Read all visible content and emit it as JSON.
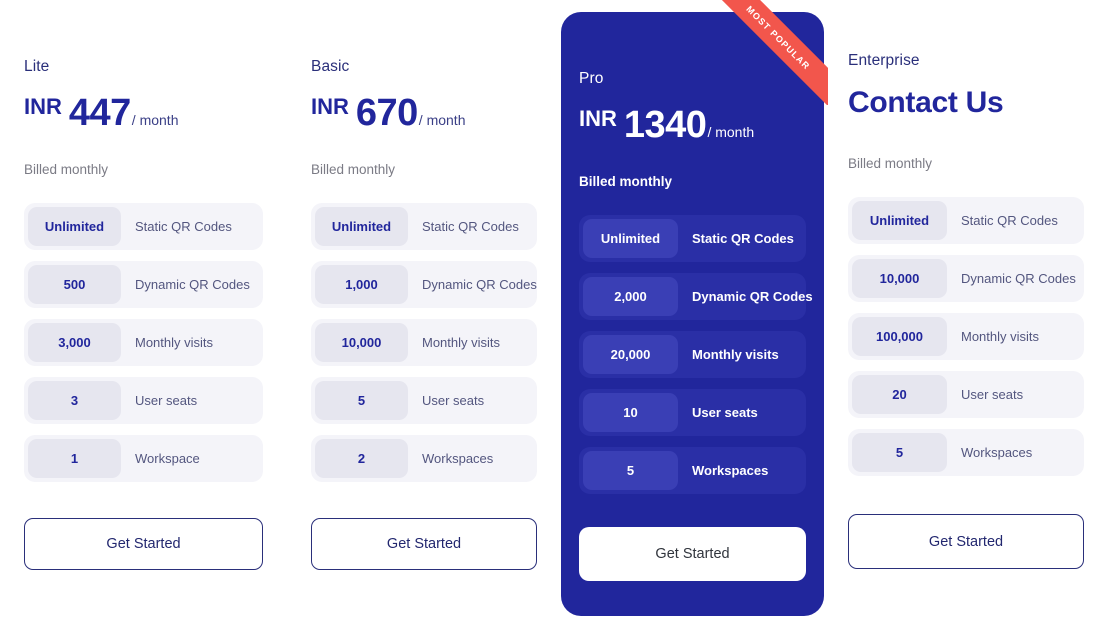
{
  "feature_labels": {
    "static": "Static QR Codes",
    "dynamic": "Dynamic QR Codes",
    "visits": "Monthly visits",
    "seats": "User seats",
    "workspace_singular": "Workspace",
    "workspace_plural": "Workspaces"
  },
  "badge": {
    "most_popular": "MOST POPULAR",
    "color": "#f2564c"
  },
  "theme": {
    "primary": "#21269c",
    "highlight_card_bg": "#21269c",
    "pill_bg": "#f4f4f9",
    "value_bg": "#e6e6ef",
    "text_navy": "#2a2f7a",
    "text_muted": "#7b7b85"
  },
  "plans": [
    {
      "name": "Lite",
      "currency": "INR",
      "amount": "447",
      "period": "/ month",
      "billed": "Billed monthly",
      "cta": "Get Started",
      "features": [
        {
          "value": "Unlimited",
          "label": "Static QR Codes"
        },
        {
          "value": "500",
          "label": "Dynamic QR Codes"
        },
        {
          "value": "3,000",
          "label": "Monthly visits"
        },
        {
          "value": "3",
          "label": "User seats"
        },
        {
          "value": "1",
          "label": "Workspace"
        }
      ]
    },
    {
      "name": "Basic",
      "currency": "INR",
      "amount": "670",
      "period": "/ month",
      "billed": "Billed monthly",
      "cta": "Get Started",
      "features": [
        {
          "value": "Unlimited",
          "label": "Static QR Codes"
        },
        {
          "value": "1,000",
          "label": "Dynamic QR Codes"
        },
        {
          "value": "10,000",
          "label": "Monthly visits"
        },
        {
          "value": "5",
          "label": "User seats"
        },
        {
          "value": "2",
          "label": "Workspaces"
        }
      ]
    },
    {
      "name": "Pro",
      "currency": "INR",
      "amount": "1340",
      "period": "/ month",
      "billed": "Billed monthly",
      "cta": "Get Started",
      "highlighted": true,
      "features": [
        {
          "value": "Unlimited",
          "label": "Static QR Codes"
        },
        {
          "value": "2,000",
          "label": "Dynamic QR Codes"
        },
        {
          "value": "20,000",
          "label": "Monthly visits"
        },
        {
          "value": "10",
          "label": "User seats"
        },
        {
          "value": "5",
          "label": "Workspaces"
        }
      ]
    },
    {
      "name": "Enterprise",
      "contact_label": "Contact Us",
      "billed": "Billed monthly",
      "cta": "Get Started",
      "features": [
        {
          "value": "Unlimited",
          "label": "Static QR Codes"
        },
        {
          "value": "10,000",
          "label": "Dynamic QR Codes"
        },
        {
          "value": "100,000",
          "label": "Monthly visits"
        },
        {
          "value": "20",
          "label": "User seats"
        },
        {
          "value": "5",
          "label": "Workspaces"
        }
      ]
    }
  ]
}
